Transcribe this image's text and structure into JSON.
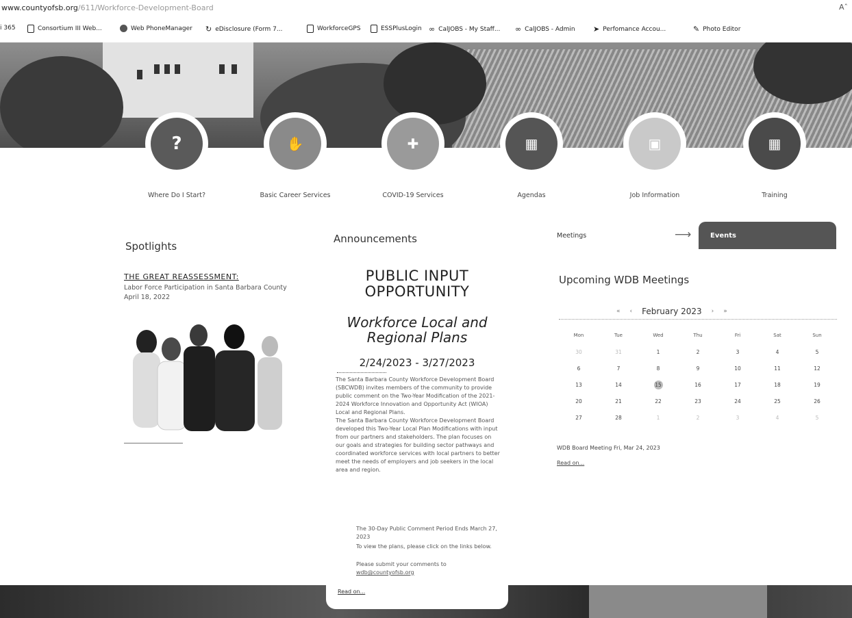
{
  "browser": {
    "url_host": "www.countyofsb.org",
    "url_path": "/611/Workforce-Development-Board",
    "zoom_indicator": "Aˆ"
  },
  "bookmarks": [
    {
      "label": "i 365",
      "icon": "none"
    },
    {
      "label": "Consortium III Web...",
      "icon": "page-icon"
    },
    {
      "label": "Web PhoneManager",
      "icon": "globe-icon"
    },
    {
      "label": "eDisclosure (Form 7...",
      "icon": "refresh-icon"
    },
    {
      "label": "WorkforceGPS",
      "icon": "page-icon"
    },
    {
      "label": "ESSPlusLogin",
      "icon": "page-icon"
    },
    {
      "label": "CalJOBS - My Staff...",
      "icon": "link-icon"
    },
    {
      "label": "CalJOBS - Admin",
      "icon": "link-icon"
    },
    {
      "label": "Perfomance Accou...",
      "icon": "pointer-icon"
    },
    {
      "label": "Photo Editor",
      "icon": "editor-icon"
    }
  ],
  "quick_links": [
    {
      "label": "Where Do I Start?",
      "icon": "question-icon",
      "color": "#5a5a5a"
    },
    {
      "label": "Basic Career Services",
      "icon": "handshake-icon",
      "color": "#8a8a8a"
    },
    {
      "label": "COVID-19 Services",
      "icon": "chat-plus-icon",
      "color": "#9a9a9a"
    },
    {
      "label": "Agendas",
      "icon": "calendar-grid-icon",
      "color": "#555555"
    },
    {
      "label": "Job Information",
      "icon": "briefcase-icon",
      "color": "#c9c9c9"
    },
    {
      "label": "Training",
      "icon": "calendar-icon",
      "color": "#4a4a4a"
    }
  ],
  "spotlights": {
    "title": "Spotlights",
    "link_text": "THE GREAT REASSESSMENT:",
    "description": "Labor Force Participation in Santa Barbara County  April 18, 2022"
  },
  "announcements": {
    "title": "Announcements",
    "headline_line1": "PUBLIC INPUT",
    "headline_line2": "OPPORTUNITY",
    "subhead_line1": "Workforce Local and",
    "subhead_line2": "Regional Plans",
    "date_range": "2/24/2023 - 3/27/2023",
    "para1": "The Santa Barbara County Workforce Development Board (SBCWDB) invites members of the community to provide public comment on the Two-Year Modification of the 2021-2024 Workforce Innovation and Opportunity Act (WIOA) Local and Regional Plans.",
    "para2": "The Santa Barbara County Workforce Development Board developed this Two-Year Local Plan Modifications with input from our partners and stakeholders. The plan focuses on our goals and strategies for building sector pathways and coordinated workforce services with local partners to better meet the needs of employers and job seekers in the local area and region.",
    "bullet1": "The 30-Day Public Comment Period Ends March 27, 2023",
    "bullet2": "To view the plans, please click on the links below.",
    "bullet3": "Please submit your comments to",
    "bullet3_link": "wdb@countyofsb.org",
    "read_on": "Read on..."
  },
  "meetings": {
    "tab_meetings": "Meetings",
    "tab_events": "Events",
    "title": "Upcoming WDB Meetings",
    "month_label": "February 2023",
    "weekdays": [
      "Mon",
      "Tue",
      "Wed",
      "Thu",
      "Fri",
      "Sat",
      "Sun"
    ],
    "weeks": [
      [
        "30",
        "31",
        "1",
        "2",
        "3",
        "4",
        "5"
      ],
      [
        "6",
        "7",
        "8",
        "9",
        "10",
        "11",
        "12"
      ],
      [
        "13",
        "14",
        "15",
        "16",
        "17",
        "18",
        "19"
      ],
      [
        "20",
        "21",
        "22",
        "23",
        "24",
        "25",
        "26"
      ],
      [
        "27",
        "28",
        "1",
        "2",
        "3",
        "4",
        "5"
      ]
    ],
    "today": "15",
    "item": "WDB Board Meeting Fri, Mar 24, 2023",
    "read_on": "Read on..."
  }
}
